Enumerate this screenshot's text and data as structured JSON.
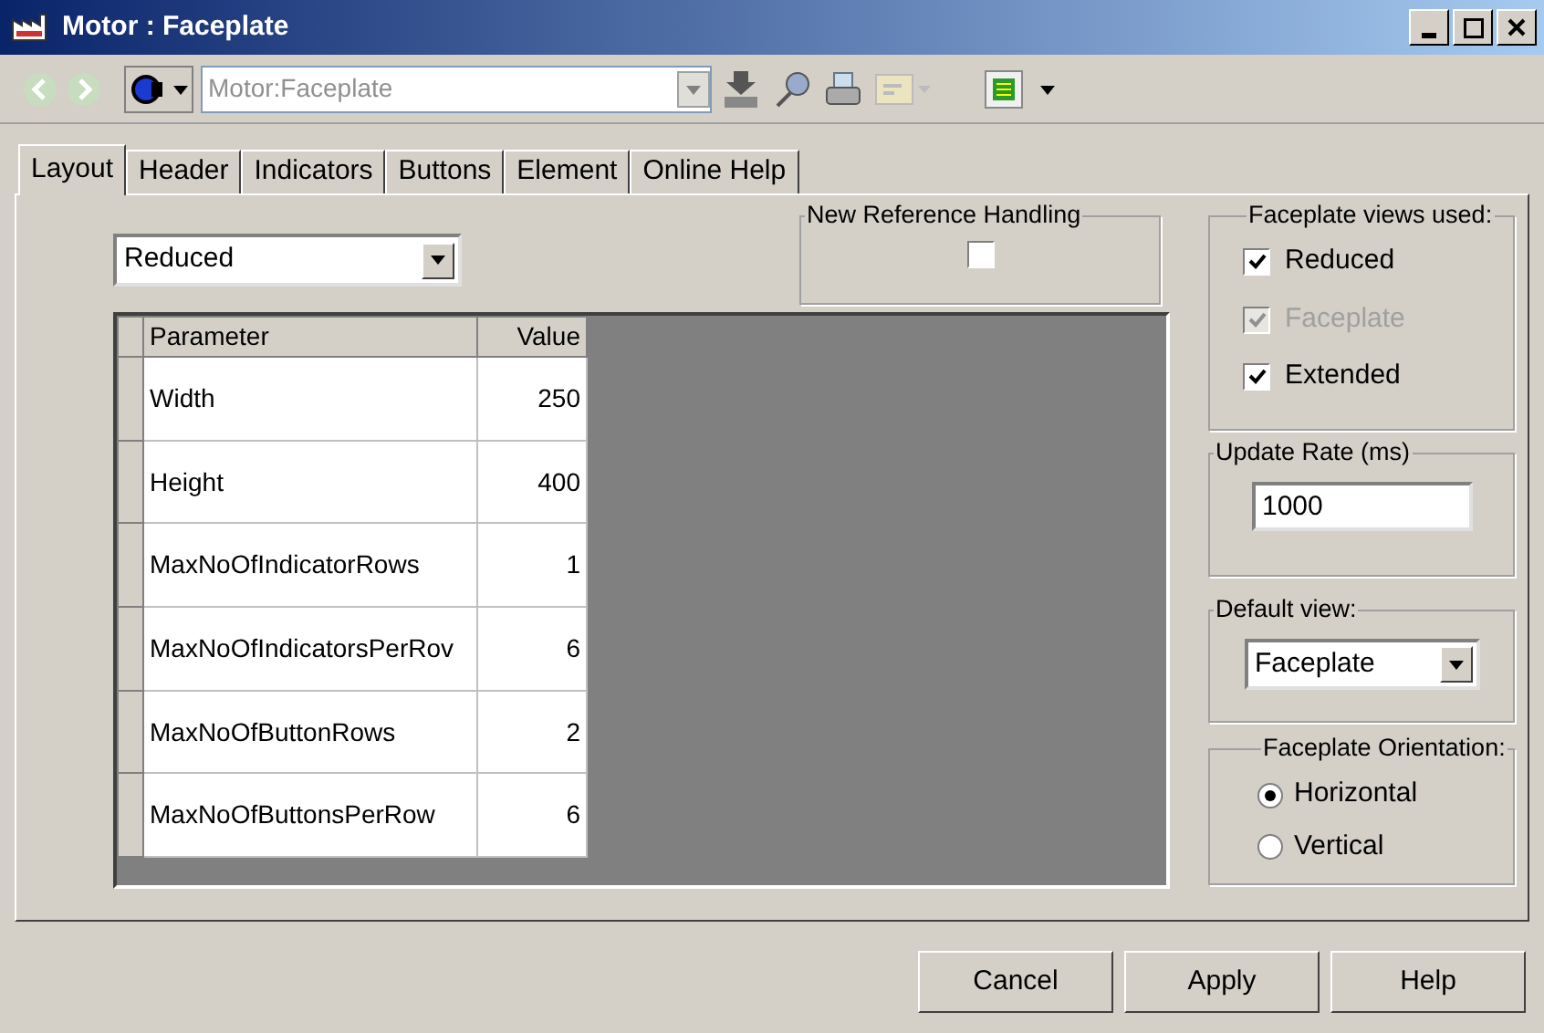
{
  "window": {
    "title": "Motor : Faceplate"
  },
  "toolbar": {
    "address": "Motor:Faceplate"
  },
  "tabs": [
    {
      "label": "Layout",
      "selected": true
    },
    {
      "label": "Header",
      "selected": false
    },
    {
      "label": "Indicators",
      "selected": false
    },
    {
      "label": "Buttons",
      "selected": false
    },
    {
      "label": "Element",
      "selected": false
    },
    {
      "label": "Online Help",
      "selected": false
    }
  ],
  "view_select": {
    "value": "Reduced"
  },
  "new_reference_handling": {
    "label": "New Reference Handling",
    "checked": false
  },
  "table": {
    "columns": [
      "Parameter",
      "Value"
    ],
    "rows": [
      {
        "parameter": "Width",
        "value": "250"
      },
      {
        "parameter": "Height",
        "value": "400"
      },
      {
        "parameter": "MaxNoOfIndicatorRows",
        "value": "1"
      },
      {
        "parameter": "MaxNoOfIndicatorsPerRov",
        "value": "6"
      },
      {
        "parameter": "MaxNoOfButtonRows",
        "value": "2"
      },
      {
        "parameter": "MaxNoOfButtonsPerRow",
        "value": "6"
      }
    ]
  },
  "faceplate_views": {
    "title": "Faceplate views used:",
    "items": [
      {
        "label": "Reduced",
        "checked": true,
        "disabled": false
      },
      {
        "label": "Faceplate",
        "checked": true,
        "disabled": true
      },
      {
        "label": "Extended",
        "checked": true,
        "disabled": false
      }
    ]
  },
  "update_rate": {
    "label": "Update Rate (ms)",
    "value": "1000"
  },
  "default_view": {
    "label": "Default view:",
    "value": "Faceplate"
  },
  "orientation": {
    "label": "Faceplate Orientation:",
    "options": [
      {
        "label": "Horizontal",
        "selected": true
      },
      {
        "label": "Vertical",
        "selected": false
      }
    ]
  },
  "buttons": [
    "Cancel",
    "Apply",
    "Help"
  ]
}
